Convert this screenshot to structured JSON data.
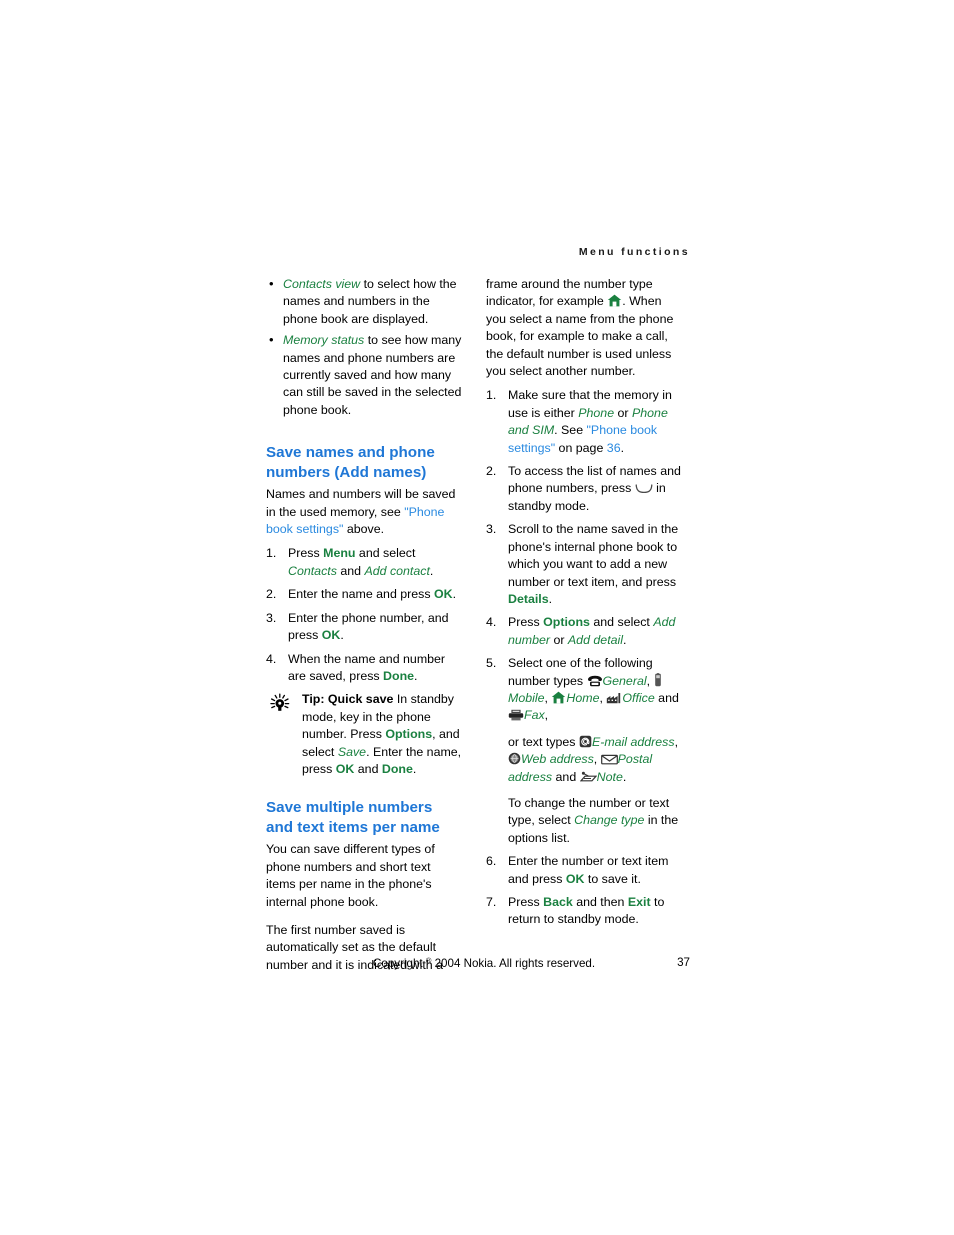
{
  "page": {
    "running_header": "Menu functions",
    "folio": "37",
    "copyright_pre": "Copyright ",
    "copyright_symbol": "®",
    "copyright_post": " 2004 Nokia. All rights reserved."
  },
  "colors": {
    "heading_blue": "#1f77d6",
    "link_blue": "#2a8ae0",
    "ui_green": "#1a8040",
    "body_black": "#000000",
    "page_background": "#ffffff"
  },
  "left_column": {
    "bullets": [
      {
        "term": "Contacts view",
        "text": " to select how the names and numbers in the phone book are displayed."
      },
      {
        "term": "Memory status",
        "text": " to see how many names and phone numbers are currently saved and how many can still be saved in the selected phone book."
      }
    ],
    "section_1": {
      "heading": "Save names and phone numbers (Add names)",
      "intro_a": "Names and numbers will be saved in the used memory, see ",
      "intro_link": "\"Phone book settings\"",
      "intro_b": " above.",
      "steps": [
        {
          "num": "1.",
          "a": "Press ",
          "key1": "Menu",
          "b": " and select ",
          "term1": "Contacts",
          "c": " and ",
          "term2": "Add contact",
          "d": "."
        },
        {
          "num": "2.",
          "a": "Enter the name and press ",
          "key1": "OK",
          "b": "."
        },
        {
          "num": "3.",
          "a": "Enter the phone number, and press ",
          "key1": "OK",
          "b": "."
        },
        {
          "num": "4.",
          "a": "When the name and number are saved, press ",
          "key1": "Done",
          "b": "."
        }
      ],
      "tip": {
        "icon": "lightbulb-icon",
        "label": "Tip: Quick save",
        "a": " In standby mode, key in the phone number. Press ",
        "key1": "Options",
        "b": ", and select ",
        "term1": "Save",
        "c": ". Enter the name, press ",
        "key2": "OK",
        "d": " and ",
        "key3": "Done",
        "e": "."
      }
    },
    "section_2": {
      "heading": "Save multiple numbers and text items per name",
      "para_1": "You can save different types of phone numbers and short text items per name in the phone's internal phone book.",
      "para_2": "The first number saved is automatically set as the default number and it is indicated with a"
    }
  },
  "right_column": {
    "continuation": {
      "a": "frame around the number type indicator, for example ",
      "icon": "home-icon",
      "b": ". When you select a name from the phone book, for example to make a call, the default number is used unless you select another number."
    },
    "steps": [
      {
        "num": "1.",
        "a": "Make sure that the memory in use is either ",
        "term1": "Phone",
        "b": " or ",
        "term2": "Phone and SIM",
        "c": ". See ",
        "link": "\"Phone book settings\"",
        "d": " on page ",
        "pageref": "36",
        "e": "."
      },
      {
        "num": "2.",
        "a": "To access the list of names and phone numbers, press ",
        "icon": "scroll-key-icon",
        "b": " in standby mode."
      },
      {
        "num": "3.",
        "a": "Scroll to the name saved in the phone's internal phone book to which you want to add a new number or text item, and press ",
        "key1": "Details",
        "b": "."
      },
      {
        "num": "4.",
        "a": "Press ",
        "key1": "Options",
        "b": " and select ",
        "term1": "Add number",
        "c": " or ",
        "term2": "Add detail",
        "d": "."
      },
      {
        "num": "5.",
        "a": "Select one of the following number types ",
        "number_types": [
          {
            "icon": "telephone-icon",
            "label": "General",
            "sep": ", "
          },
          {
            "icon": "mobile-phone-icon",
            "label": "Mobile",
            "sep": ", "
          },
          {
            "icon": "home-icon",
            "label": "Home",
            "sep": ", "
          },
          {
            "icon": "office-building-icon",
            "label": "Office",
            "sep": " and "
          },
          {
            "icon": "fax-icon",
            "label": "Fax",
            "sep": ","
          }
        ],
        "text_types_lead": "or text types ",
        "text_types": [
          {
            "icon": "email-at-icon",
            "label": "E-mail address",
            "sep": ", "
          },
          {
            "icon": "web-globe-icon",
            "label": "Web address",
            "sep": ", "
          },
          {
            "icon": "postal-envelope-icon",
            "label": "Postal address",
            "sep": " and "
          },
          {
            "icon": "note-pen-icon",
            "label": "Note",
            "sep": "."
          }
        ],
        "change_a": "To change the number or text type, select ",
        "change_term": "Change type",
        "change_b": " in the options list."
      },
      {
        "num": "6.",
        "a": "Enter the number or text item and press ",
        "key1": "OK",
        "b": " to save it."
      },
      {
        "num": "7.",
        "a": "Press ",
        "key1": "Back",
        "b": " and then ",
        "key2": "Exit",
        "c": " to return to standby mode."
      }
    ]
  }
}
